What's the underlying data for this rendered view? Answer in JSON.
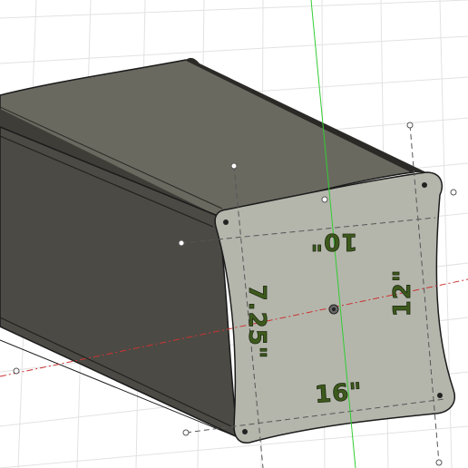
{
  "viewport": {
    "label": "3D modeling canvas"
  },
  "sketch": {
    "dimensions": {
      "top": "10\"",
      "bottom": "16\"",
      "left": "7.25\"",
      "right": "12\""
    }
  },
  "colors": {
    "background": "#ffffff",
    "grid": "#e2e2e2",
    "body_dark": "#4b4a44",
    "body_mid": "#6a6960",
    "body_light": "#8a897f",
    "profile_face": "#b4b6ac",
    "dimension_text": "#3d5a1c",
    "y_axis": "#33cc33",
    "x_axis": "#cc3333",
    "construction_line": "#555555"
  }
}
